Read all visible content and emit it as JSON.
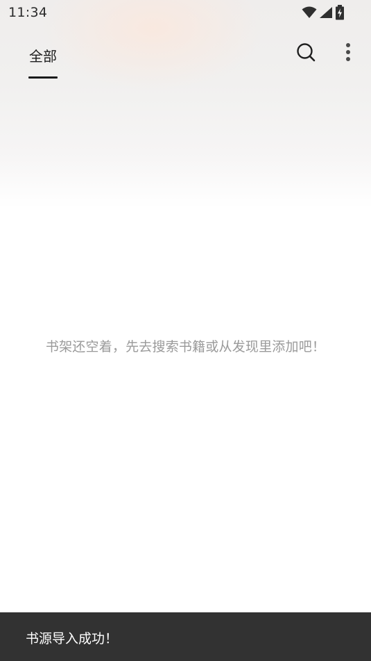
{
  "status_bar": {
    "time": "11:34",
    "icons": [
      "wifi-icon",
      "cellular-signal-icon",
      "battery-charging-icon"
    ]
  },
  "toolbar": {
    "tabs": [
      {
        "label": "全部",
        "selected": true
      }
    ],
    "actions": [
      "search-icon",
      "more-vert-icon"
    ]
  },
  "bookshelf": {
    "empty_message": "书架还空着，先去搜索书籍或从发现里添加吧！"
  },
  "snackbar": {
    "message": "书源导入成功！"
  },
  "colors": {
    "snackbar_bg": "#323232",
    "tab_indicator": "#1a1a1a",
    "empty_text": "#9a9a9a"
  }
}
